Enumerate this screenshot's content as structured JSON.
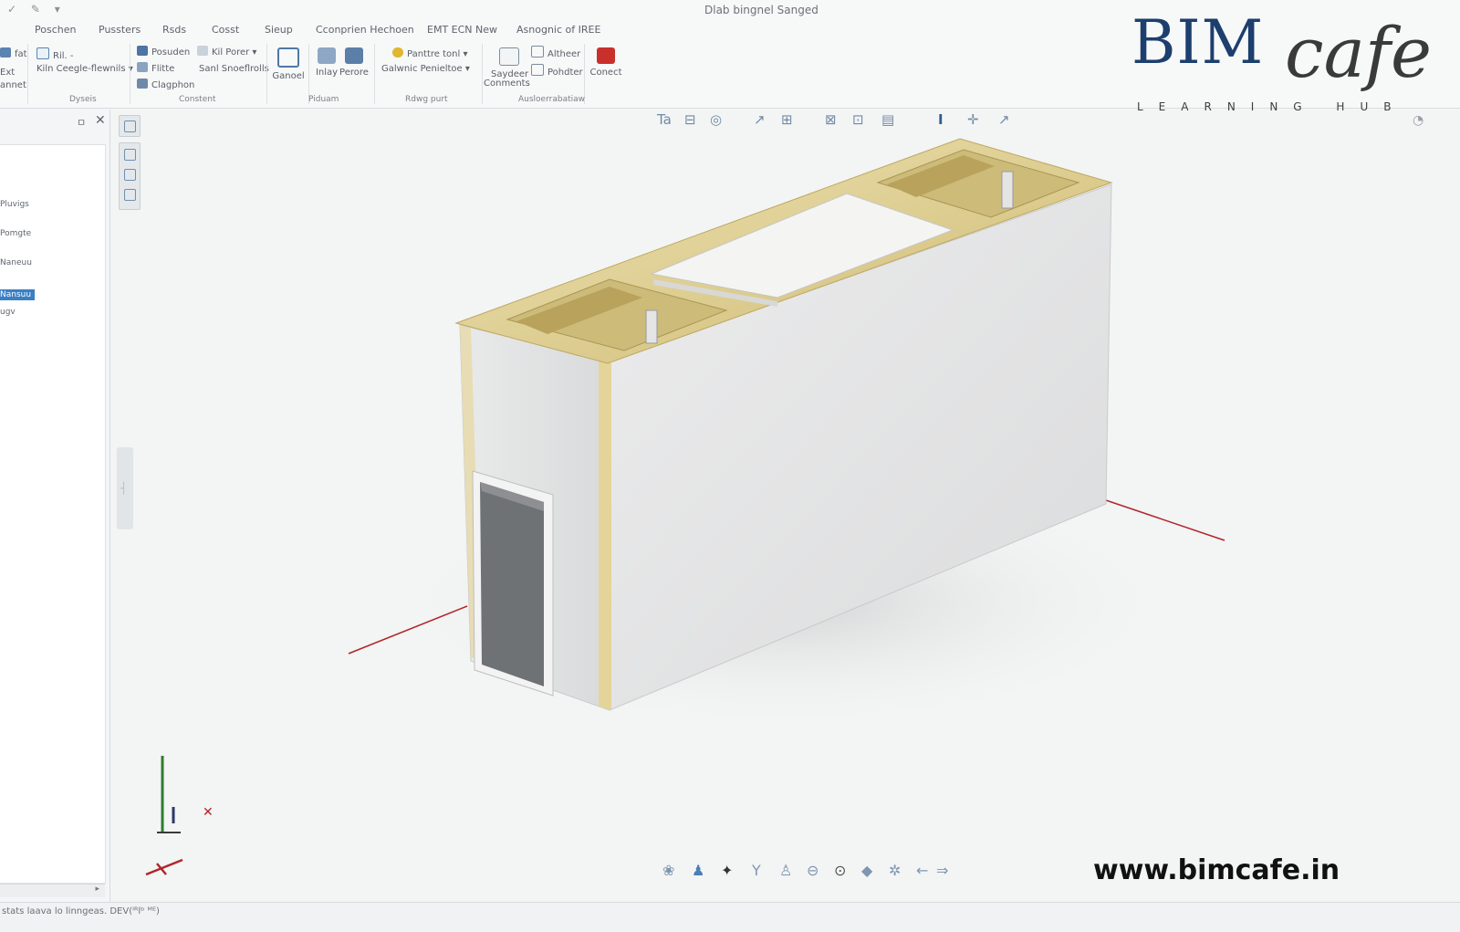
{
  "window": {
    "title": "Dlab bingnel Sanged",
    "qat": "✓ ✎ ▾"
  },
  "ribbon": {
    "tabs": [
      "Poschen",
      "Pussters",
      "Rsds",
      "Cosst",
      "Sieup",
      "Cconprien Hechoen",
      "EMT ECN New",
      "Asnognic of IREE"
    ],
    "tools": {
      "col1_a": "fat",
      "col1_b": "Ext",
      "col1_c": "annet",
      "col2_a": "Ril. -",
      "col2_b": "Kiln Ceegle-flewnils ▾",
      "col3_a": "Posuden",
      "col3_b": "Flitte",
      "col3_c": "Clagphon",
      "col4_a": "Kil Porer ▾",
      "col4_b": "Sanl Snoeflrolls",
      "big1": "Ganoel",
      "big2": "Inlay",
      "big3": "Perore",
      "col5_a": "Panttre tonl ▾",
      "col5_b": "Galwnic Penieltoe ▾",
      "col6_a": "Saydeer",
      "col6_b": "Conments",
      "col7_a": "Altheer",
      "col7_b": "Pohdter",
      "big4": "Conect"
    },
    "panels": [
      "Dyseis",
      "Constent",
      "Piduam",
      "Rdwg purt",
      "Ausloerrabatiaw"
    ]
  },
  "browser": {
    "pin": "ㅁ",
    "close": "✕",
    "items": [
      "Pluvigs",
      "Pomgte",
      "Naneuu"
    ],
    "selected": "Nansuu",
    "after": "ugv",
    "scroll_arrow": "▸"
  },
  "canvas": {
    "top_icons": [
      "Ta",
      "⊟",
      "◎",
      "↗",
      "⊞",
      "⊠",
      "⊡",
      "▤",
      "I",
      "✛",
      "↗"
    ],
    "bottom_icons": [
      "❀",
      "♟",
      "✦",
      "Y",
      "♙",
      "⊖",
      "⊙",
      "◆",
      "✲",
      "←",
      "⇒"
    ],
    "side_tab": "┤"
  },
  "watermark": {
    "brand_main": "BIM",
    "brand_script": "cafe",
    "tagline": "LEARNING HUB",
    "website": "www.bimcafe.in"
  },
  "status": {
    "text": "stats laava lo linngeas. DEV(ᴵᴿlᵇ ᴹᴱ)"
  },
  "colors": {
    "ribbon_bg": "#f7f8f8",
    "canvas_bg": "#f3f4f4",
    "wall_front": "#d6d7d8",
    "wall_side": "#e7e8e9",
    "gold_trim": "#e4d49a",
    "logo_blue": "#1c3f6e",
    "axis_red": "#b0252b",
    "axis_green": "#2e7d32",
    "selection_blue": "#3b7fc4"
  }
}
